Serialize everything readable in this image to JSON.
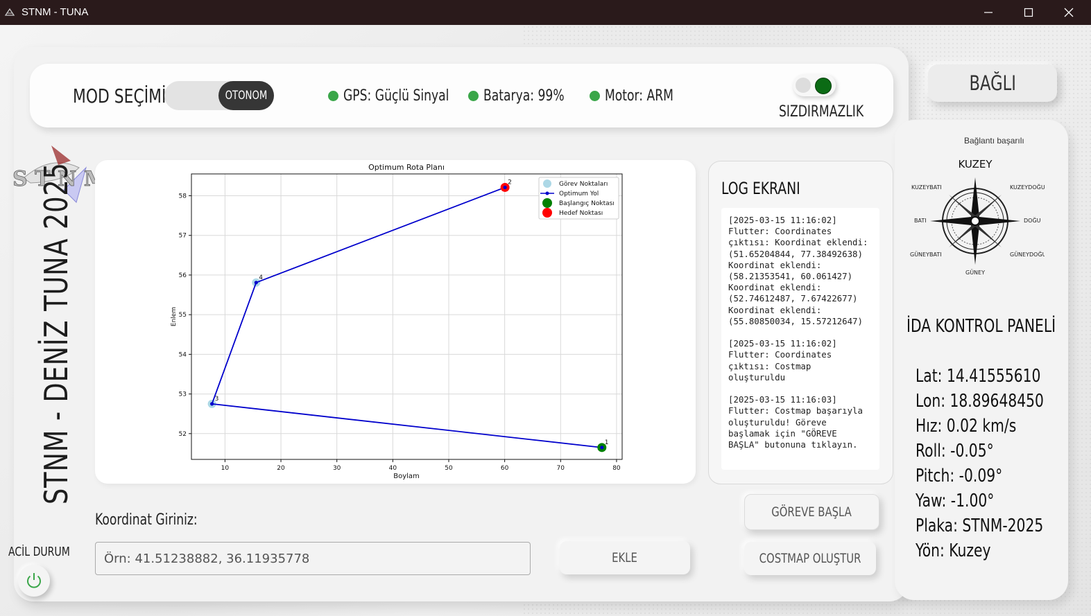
{
  "window": {
    "title": "STNM - TUNA"
  },
  "topbar": {
    "mode_label": "MOD SEÇİMİ",
    "mode_value": "OTONOM",
    "gps": "GPS: Güçlü Sinyal",
    "battery": "Batarya: 99%",
    "motor": "Motor: ARM",
    "leak_label": "SIZDIRMAZLIK",
    "status_color": "#3aa649"
  },
  "connection": {
    "button_label": "BAĞLI",
    "status_text": "Bağlantı başarılı"
  },
  "sidebar": {
    "vertical_title": "STNM - DENİZ TUNA 2025",
    "emergency_label": "ACİL DURUM"
  },
  "chart_data": {
    "type": "line",
    "title": "Optimum Rota Planı",
    "xlabel": "Boylam",
    "ylabel": "Enlem",
    "xlim": [
      4.0,
      81.0
    ],
    "ylim": [
      51.35,
      58.55
    ],
    "xticks": [
      10,
      20,
      30,
      40,
      50,
      60,
      70,
      80
    ],
    "yticks": [
      52,
      53,
      54,
      55,
      56,
      57,
      58
    ],
    "grid": true,
    "legend_position": "top-right",
    "legend": [
      "Görev Noktaları",
      "Optimum Yol",
      "Başlangıç Noktası",
      "Hedef Noktası"
    ],
    "points": [
      {
        "label": "1",
        "x": 77.38,
        "y": 51.65
      },
      {
        "label": "2",
        "x": 60.06,
        "y": 58.21
      },
      {
        "label": "3",
        "x": 7.67,
        "y": 52.75
      },
      {
        "label": "4",
        "x": 15.57,
        "y": 55.81
      }
    ],
    "route": [
      [
        77.38,
        51.65
      ],
      [
        7.67,
        52.75
      ],
      [
        15.57,
        55.81
      ],
      [
        60.06,
        58.21
      ]
    ],
    "start": {
      "x": 77.38,
      "y": 51.65
    },
    "target": {
      "x": 60.06,
      "y": 58.21
    },
    "colors": {
      "task": "#add8e6",
      "path": "#0000cc",
      "start": "#008000",
      "target": "#ff0000"
    }
  },
  "log": {
    "title": "LOG EKRANI",
    "text": "[2025-03-15 11:16:02]\nFlutter: Coordinates çıktısı: Koordinat eklendi: (51.65204844, 77.38492638)\nKoordinat eklendi: (58.21353541, 60.061427)\nKoordinat eklendi: (52.74612487, 7.67422677)\nKoordinat eklendi: (55.80850034, 15.57212647)\n\n[2025-03-15 11:16:02]\nFlutter: Coordinates çıktısı: Costmap oluşturuldu\n\n[2025-03-15 11:16:03]\nFlutter: Costmap başarıyla oluşturuldu! Göreve başlamak için \"GÖREVE BAŞLA\" butonuna tıklayın."
  },
  "compass": {
    "north": "KUZEY",
    "south": "GÜNEY",
    "east": "DOĞU",
    "west": "BATI",
    "northeast": "KUZEYDOĞU",
    "northwest": "KUZEYBATI",
    "southeast": "GÜNEYDOĞU",
    "southwest": "GÜNEYBATI"
  },
  "panel": {
    "title": "İDA KONTROL PANELİ",
    "lat": "Lat: 14.41555610",
    "lon": "Lon: 18.89648450",
    "speed": "Hız: 0.02 km/s",
    "roll": "Roll: -0.05°",
    "pitch": "Pitch: -0.09°",
    "yaw": "Yaw: -1.00°",
    "plate": "Plaka: STNM-2025",
    "heading": "Yön: Kuzey"
  },
  "coordinate_input": {
    "label": "Koordinat Giriniz:",
    "placeholder": "Örn: 41.51238882, 36.11935778"
  },
  "buttons": {
    "add": "EKLE",
    "start_mission": "GÖREVE BAŞLA",
    "costmap": "COSTMAP OLUŞTUR"
  }
}
